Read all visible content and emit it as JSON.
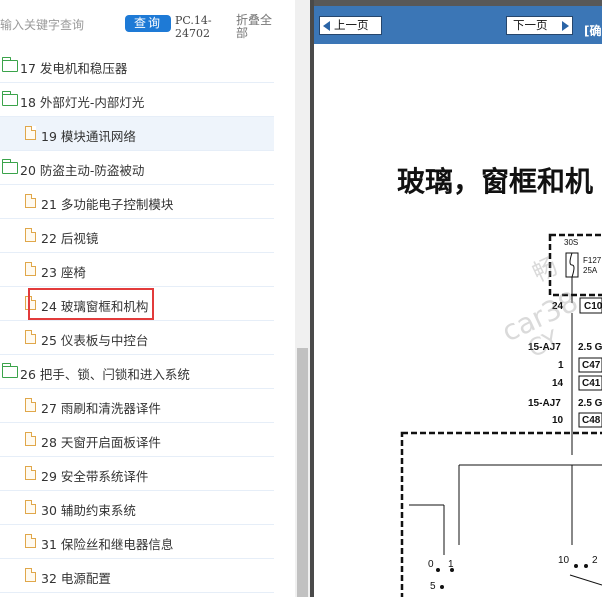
{
  "search": {
    "placeholder": "输入关键字查询",
    "button_label": "查询"
  },
  "doc_code": "PC.14-24702",
  "collapse_all_label": "折叠全部",
  "tree": [
    {
      "type": "folder",
      "label": "17 发电机和稳压器",
      "highlighted": false
    },
    {
      "type": "folder",
      "label": "18 外部灯光-内部灯光",
      "highlighted": false
    },
    {
      "type": "file",
      "label": "19 模块通讯网络",
      "highlighted": true
    },
    {
      "type": "folder",
      "label": "20 防盗主动-防盗被动",
      "highlighted": false
    },
    {
      "type": "file",
      "label": "21 多功能电子控制模块",
      "highlighted": false
    },
    {
      "type": "file",
      "label": "22 后视镜",
      "highlighted": false
    },
    {
      "type": "file",
      "label": "23 座椅",
      "highlighted": false
    },
    {
      "type": "file",
      "label": "24 玻璃窗框和机构",
      "highlighted": false,
      "boxed": true
    },
    {
      "type": "file",
      "label": "25 仪表板与中控台",
      "highlighted": false
    },
    {
      "type": "folder",
      "label": "26 把手、锁、闩锁和进入系统",
      "highlighted": false
    },
    {
      "type": "file",
      "label": "27 雨刷和清洗器译件",
      "highlighted": false
    },
    {
      "type": "file",
      "label": "28 天窗开启面板译件",
      "highlighted": false
    },
    {
      "type": "file",
      "label": "29 安全带系统译件",
      "highlighted": false
    },
    {
      "type": "file",
      "label": "30 辅助约束系统",
      "highlighted": false
    },
    {
      "type": "file",
      "label": "31 保险丝和继电器信息",
      "highlighted": false
    },
    {
      "type": "file",
      "label": "32 电源配置",
      "highlighted": false
    }
  ],
  "viewer": {
    "prev_label": "上一页",
    "next_label": "下一页",
    "nav_title": "[确",
    "doc_title": "玻璃，窗框和机",
    "watermarks": [
      "car38",
      "CY",
      "畅"
    ],
    "diagram_labels": {
      "fuse_top": "30S",
      "fuse_name": "F127",
      "fuse_amp": "25A",
      "pin_24": "24",
      "conn_c1": "C10",
      "w1": "15-AJ7",
      "w1b": "2.5 G",
      "pin_1": "1",
      "conn_c47": "C47",
      "pin_14": "14",
      "conn_c41": "C41",
      "w2": "15-AJ7",
      "w2b": "2.5 G",
      "pin_10": "10",
      "conn_c48": "C48",
      "sw_0": "0",
      "sw_1": "1",
      "sw_5": "5",
      "sw_10": "10",
      "sw_2": "2"
    }
  },
  "colors": {
    "accent": "#1e7ad6",
    "navbar": "#3b76b6",
    "highlight_box": "#e23b3b",
    "folder": "#3aa34a",
    "file": "#e0a74a"
  }
}
